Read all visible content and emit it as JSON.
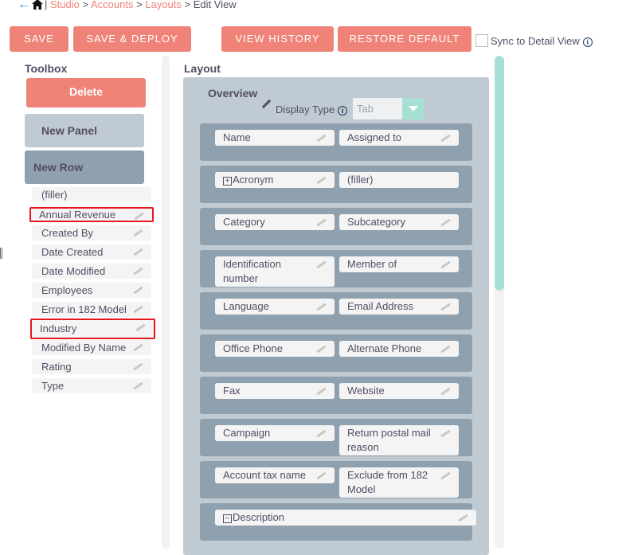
{
  "breadcrumb": {
    "studio": "Studio",
    "accounts": "Accounts",
    "layouts": "Layouts",
    "current": "Edit View",
    "sep": ">",
    "bar": "|"
  },
  "toolbar": {
    "save": "SAVE",
    "save_deploy": "SAVE & DEPLOY",
    "view_history": "VIEW HISTORY",
    "restore_default": "RESTORE DEFAULT",
    "sync_label": "Sync to Detail View"
  },
  "toolbox": {
    "title": "Toolbox",
    "delete": "Delete",
    "new_panel": "New Panel",
    "new_row": "New Row",
    "items": [
      "(filler)",
      "Annual Revenue",
      "Created By",
      "Date Created",
      "Date Modified",
      "Employees",
      "Error in 182 Model",
      "Industry",
      "Modified By Name",
      "Rating",
      "Type"
    ]
  },
  "layout": {
    "title": "Layout",
    "panel_name": "Overview",
    "display_type_label": "Display Type",
    "display_type_value": "Tab",
    "rows": [
      [
        "Name",
        "Assigned to"
      ],
      [
        "Acronym",
        "(filler)"
      ],
      [
        "Category",
        "Subcategory"
      ],
      [
        "Identification number",
        "Member of"
      ],
      [
        "Language",
        "Email Address"
      ],
      [
        "Office Phone",
        "Alternate Phone"
      ],
      [
        "Fax",
        "Website"
      ],
      [
        "Campaign",
        "Return postal mail reason"
      ],
      [
        "Account tax name",
        "Exclude from 182 Model"
      ],
      [
        "Description"
      ]
    ]
  },
  "colors": {
    "accent": "#f08377",
    "panel": "#bfcad3",
    "row": "#8fa1ae",
    "teal": "#a5e0d2",
    "highlight": "#e8171d"
  }
}
